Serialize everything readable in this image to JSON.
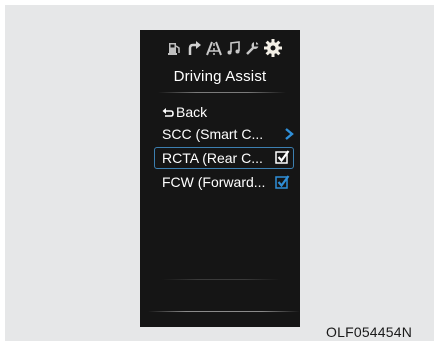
{
  "menu": {
    "title": "Driving Assist",
    "tab_icons": [
      "fuel-icon",
      "navigation-arrow-icon",
      "road-lanes-icon",
      "music-note-icon",
      "wrench-icon",
      "gear-icon"
    ],
    "back_label": "Back",
    "items": [
      {
        "label": "SCC (Smart C...",
        "control": "chevron-right-icon"
      },
      {
        "label": "RCTA (Rear C...",
        "control": "checkbox",
        "checked": true,
        "selected": true
      },
      {
        "label": "FCW (Forward...",
        "control": "checkbox",
        "checked": true
      }
    ]
  },
  "colors": {
    "screen_bg": "#151515",
    "accent_blue": "#2f8fd8",
    "selection_border": "#3c7fb0",
    "gear_active": "#f3efe6"
  },
  "caption": "OLF054454N"
}
